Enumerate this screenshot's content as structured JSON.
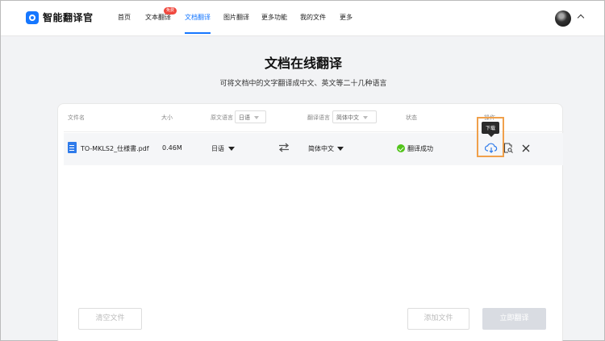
{
  "brand": {
    "name": "智能翻译官"
  },
  "nav": {
    "items": [
      {
        "label": "首页"
      },
      {
        "label": "文本翻译"
      },
      {
        "label": "文档翻译"
      },
      {
        "label": "图片翻译"
      },
      {
        "label": "更多功能"
      },
      {
        "label": "我的文件"
      },
      {
        "label": "更多"
      }
    ],
    "free_badge": "免费",
    "active": "文档翻译"
  },
  "page": {
    "title": "文档在线翻译",
    "subtitle": "可将文档中的文字翻译成中文、英文等二十几种语言"
  },
  "table": {
    "headers": {
      "file_name": "文件名",
      "size": "大小",
      "source_lang": "原文语言",
      "target_lang": "翻译语言",
      "status": "状态",
      "actions": "操作"
    },
    "source_lang_filter": "日语",
    "target_lang_filter": "简体中文",
    "rows": [
      {
        "file_name": "TO-MKLS2_仕様書.pdf",
        "size": "0.46M",
        "source_lang": "日语",
        "target_lang": "简体中文",
        "status": "翻译成功"
      }
    ],
    "download_tooltip": "下载"
  },
  "buttons": {
    "clear": "清空文件",
    "add": "添加文件",
    "translate": "立即翻译"
  },
  "colors": {
    "accent": "#1677ff",
    "success": "#52c41a",
    "highlight": "#f0a04b"
  }
}
